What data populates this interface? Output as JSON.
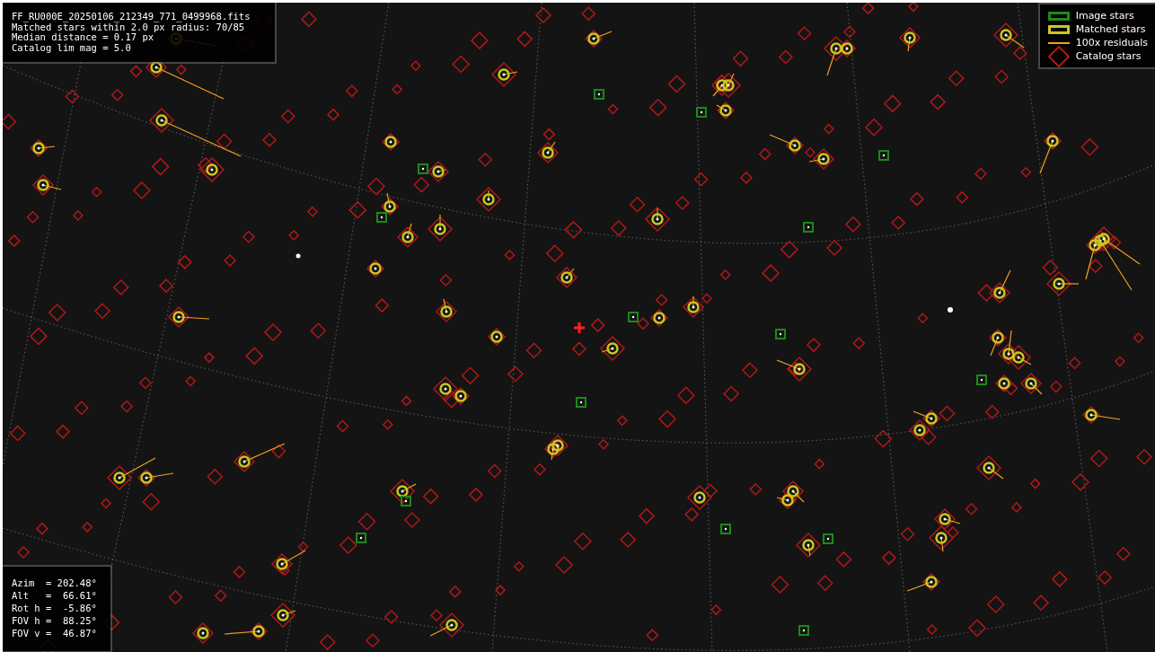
{
  "info_box": {
    "lines": [
      "FF_RU000E_20250106_212349_771_0499968.fits",
      "Matched stars within 2.0 px radius: 70/85",
      "Median distance = 0.17 px",
      "Catalog lim mag = 5.0"
    ]
  },
  "legend": {
    "items": [
      {
        "kind": "image",
        "label": "Image stars",
        "color": "#1a8a1a"
      },
      {
        "kind": "matched",
        "label": "Matched stars",
        "color": "#c8c81e"
      },
      {
        "kind": "residual",
        "label": "100x residuals",
        "color": "#f0a020"
      },
      {
        "kind": "catalog",
        "label": "Catalog stars",
        "color": "#b01818"
      }
    ]
  },
  "pointing_box": {
    "lines": [
      "Azim  = 202.48°",
      "Alt   =  66.61°",
      "Rot h =  -5.86°",
      "FOV h =  88.25°",
      "FOV v =  46.87°"
    ]
  }
}
